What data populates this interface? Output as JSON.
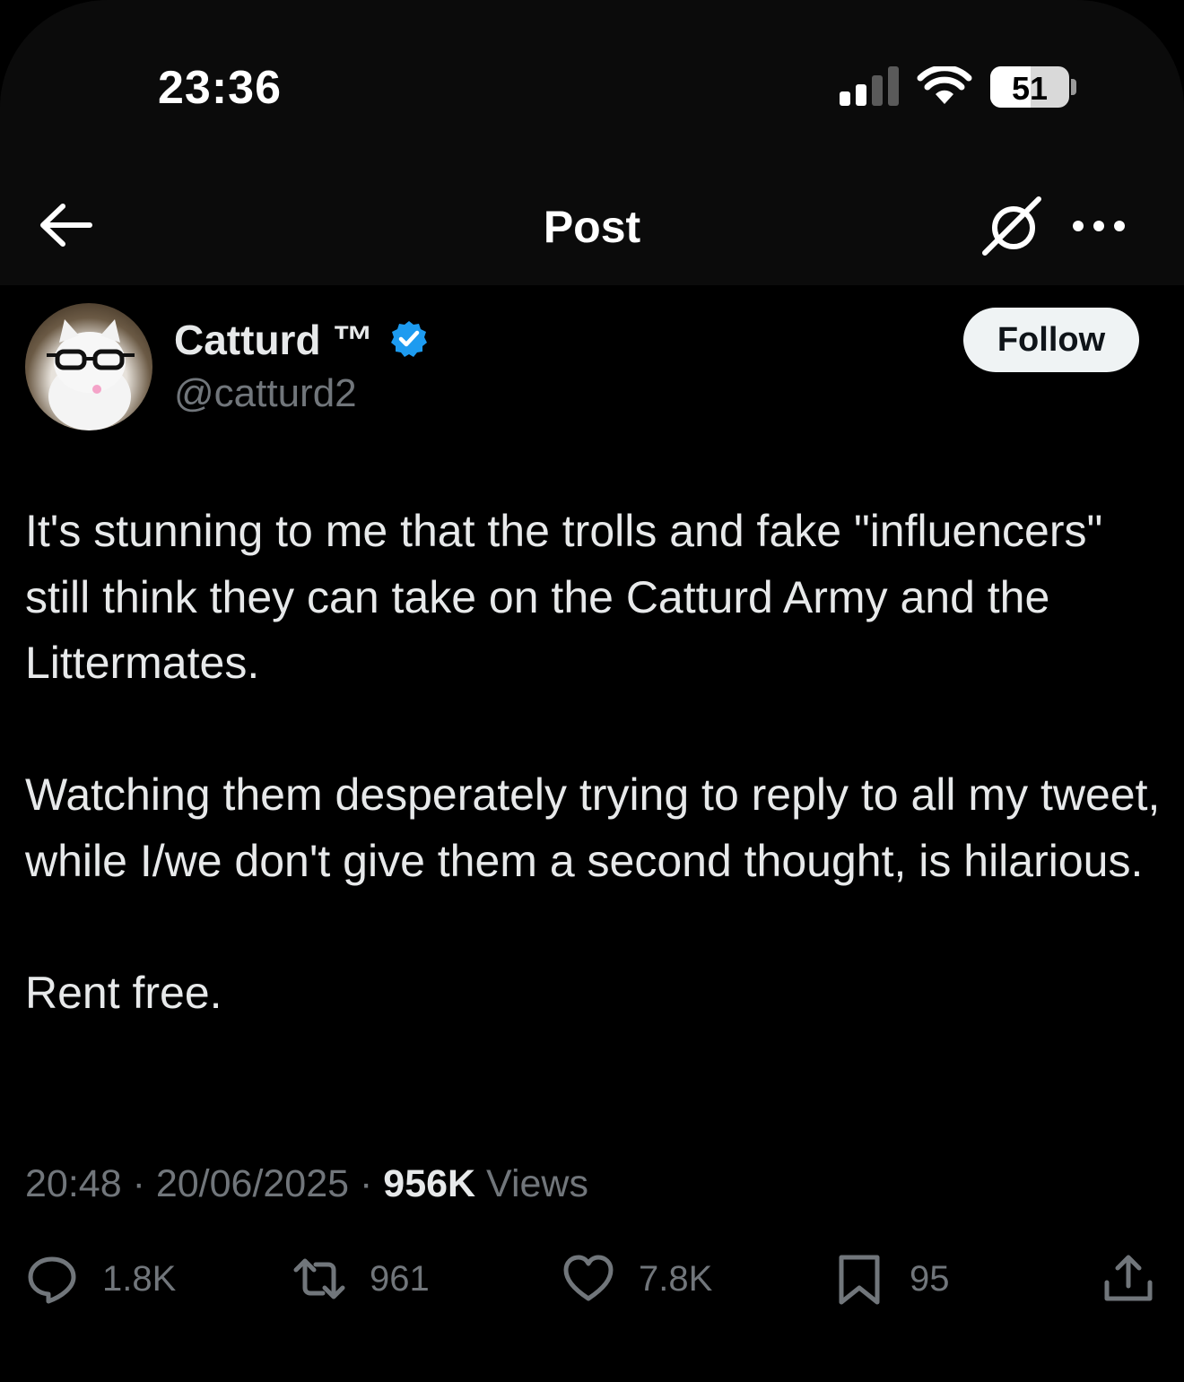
{
  "status_bar": {
    "time": "23:36",
    "battery_text": "51",
    "battery_level": 0.51,
    "icons": [
      "cellular-signal-icon",
      "wifi-icon",
      "battery-icon"
    ]
  },
  "nav": {
    "title": "Post",
    "icons": [
      "back-arrow-icon",
      "grok-icon",
      "more-icon"
    ]
  },
  "author": {
    "name": "Catturd ™",
    "handle": "@catturd2",
    "verified_color": "#1d9bf0",
    "follow_label": "Follow"
  },
  "tweet": {
    "paragraphs": [
      "It's stunning to me that the trolls and fake \"influencers\" still think they can take on the Catturd Army and the Littermates.",
      "Watching them desperately trying to reply to all my tweet, while I/we don't give them a second thought, is hilarious.",
      "Rent free."
    ]
  },
  "meta": {
    "time": "20:48",
    "separator": "·",
    "date": "20/06/2025",
    "views_count": "956K",
    "views_label": "Views"
  },
  "actions": {
    "replies": "1.8K",
    "reposts": "961",
    "likes": "7.8K",
    "bookmarks": "95"
  },
  "colors": {
    "background": "#000000",
    "header_bg": "#0b0b0b",
    "text_primary": "#e7e9ea",
    "text_secondary": "#71767b",
    "follow_bg": "#eff3f4"
  }
}
